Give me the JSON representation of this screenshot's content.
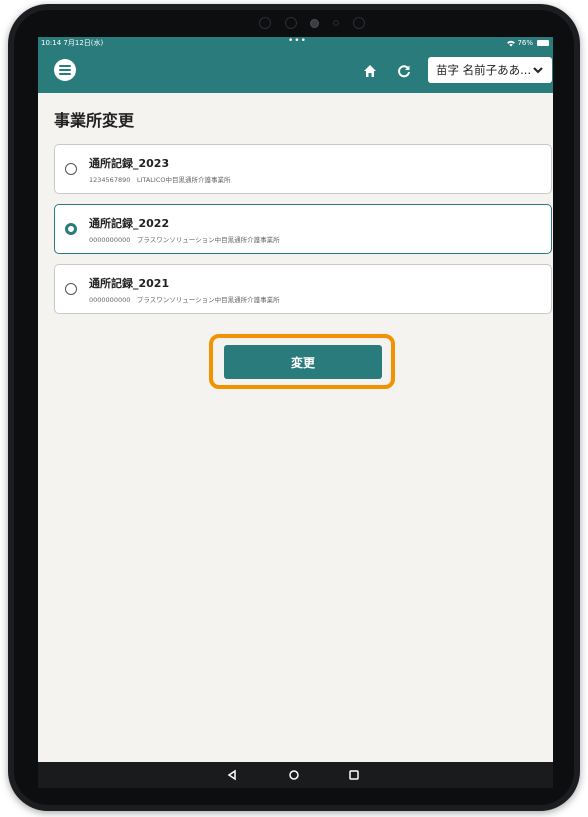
{
  "status_bar": {
    "time": "10:14",
    "date": "7月12日(水)",
    "dots": "•••",
    "battery_text": "76%"
  },
  "header": {
    "user_name": "苗字 名前子ああ...",
    "icons": [
      "menu-icon",
      "home-icon",
      "refresh-icon",
      "chevron-down-icon"
    ]
  },
  "page": {
    "title": "事業所変更"
  },
  "options": [
    {
      "title": "通所記録_2023",
      "subtitle": "1234567890　LITALICO中目黒通所介護事業所",
      "selected": false
    },
    {
      "title": "通所記録_2022",
      "subtitle": "0000000000　プラスワンソリューション中目黒通所介護事業所",
      "selected": true
    },
    {
      "title": "通所記録_2021",
      "subtitle": "0000000000　プラスワンソリューション中目黒通所介護事業所",
      "selected": false
    }
  ],
  "actions": {
    "change_label": "変更"
  },
  "colors": {
    "primary": "#2a7b7c",
    "highlight": "#f29200",
    "background": "#f5f3ef"
  }
}
